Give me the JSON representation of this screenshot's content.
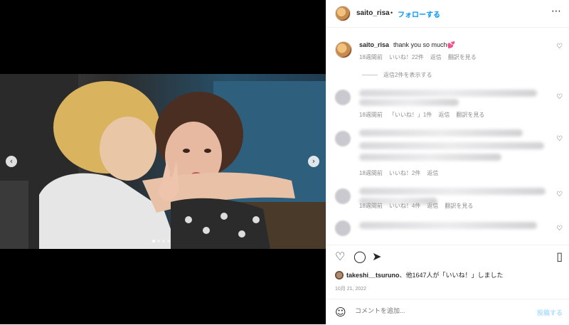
{
  "header": {
    "username": "saito_risa",
    "separator": "•",
    "follow_label": "フォローする",
    "more_icon": "more-horizontal-icon"
  },
  "caption": {
    "username": "saito_risa",
    "text": "thank you so much💕",
    "time": "18週間前",
    "likes": "いいね！22件",
    "reply": "返信",
    "translate": "翻訳を見る"
  },
  "show_replies": "返信2件を表示する",
  "comments": [
    {
      "time": "18週間前",
      "likes": "「いいね！」1件",
      "reply": "返信",
      "translate": "翻訳を見る"
    },
    {
      "time": "18週間前",
      "likes": "いいね！2件",
      "reply": "返信",
      "translate": ""
    },
    {
      "time": "18週間前",
      "likes": "いいね！4件",
      "reply": "返信",
      "translate": "翻訳を見る"
    }
  ],
  "likes_summary": {
    "user": "takeshi__tsuruno",
    "rest": "、他1647人が「いいね！」しました"
  },
  "date": "10月 21, 2022",
  "comment_box": {
    "placeholder": "コメントを追加...",
    "post_label": "投稿する"
  },
  "carousel": {
    "total": 4,
    "active_index": 0
  }
}
